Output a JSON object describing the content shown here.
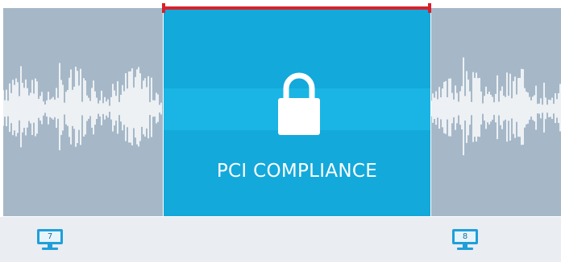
{
  "segment": {
    "label": "PCI COMPLIANCE",
    "icon": "lock-icon"
  },
  "markers": {
    "left_monitor": {
      "number": "7",
      "icon": "monitor-icon"
    },
    "right_monitor": {
      "number": "8",
      "icon": "monitor-icon"
    }
  },
  "colors": {
    "segment_fill": "#13a9db",
    "waveform_bg": "#a6b8c8",
    "range_marker": "#d9202a",
    "footer_bg": "#eaedf2",
    "monitor_icon": "#1f9fd9"
  }
}
